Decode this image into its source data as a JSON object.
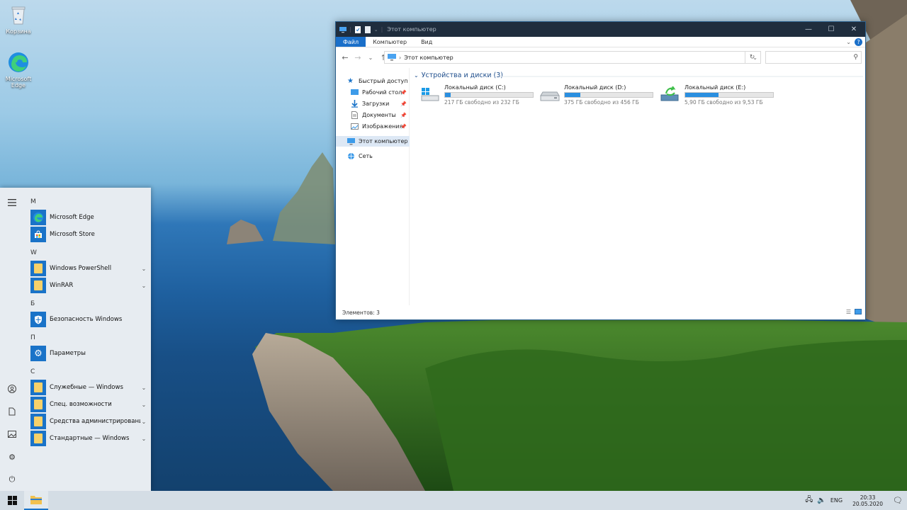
{
  "desktop": {
    "icons": [
      {
        "label": "Корзина",
        "icon": "recycle-bin-icon"
      },
      {
        "label": "Microsoft Edge",
        "icon": "edge-icon"
      }
    ]
  },
  "start_menu": {
    "sections": [
      {
        "letter": "M",
        "items": [
          {
            "label": "Microsoft Edge",
            "icon": "edge-icon",
            "expandable": false
          },
          {
            "label": "Microsoft Store",
            "icon": "store-icon",
            "expandable": false
          }
        ]
      },
      {
        "letter": "W",
        "items": [
          {
            "label": "Windows PowerShell",
            "icon": "folder-icon",
            "expandable": true
          },
          {
            "label": "WinRAR",
            "icon": "folder-icon",
            "expandable": true
          }
        ]
      },
      {
        "letter": "Б",
        "items": [
          {
            "label": "Безопасность Windows",
            "icon": "shield-icon",
            "expandable": false
          }
        ]
      },
      {
        "letter": "П",
        "items": [
          {
            "label": "Параметры",
            "icon": "gear-icon",
            "expandable": false
          }
        ]
      },
      {
        "letter": "С",
        "items": [
          {
            "label": "Служебные — Windows",
            "icon": "folder-icon",
            "expandable": true
          },
          {
            "label": "Спец. возможности",
            "icon": "folder-icon",
            "expandable": true
          },
          {
            "label": "Средства администрирования...",
            "icon": "folder-icon",
            "expandable": true
          },
          {
            "label": "Стандартные — Windows",
            "icon": "folder-icon",
            "expandable": true
          }
        ]
      }
    ],
    "rail_icons": [
      "hamburger-icon",
      "user-icon",
      "document-icon",
      "pictures-icon",
      "settings-icon",
      "power-icon"
    ]
  },
  "explorer": {
    "title": "Этот компьютер",
    "ribbon_tabs": [
      {
        "label": "Файл",
        "active": true
      },
      {
        "label": "Компьютер",
        "active": false
      },
      {
        "label": "Вид",
        "active": false
      }
    ],
    "address": "Этот компьютер",
    "search_placeholder": "",
    "nav_items": [
      {
        "label": "Быстрый доступ",
        "icon": "star-icon",
        "pinned": false,
        "indent": 0,
        "selected": false
      },
      {
        "label": "Рабочий стол",
        "icon": "desktop-icon",
        "pinned": true,
        "indent": 1,
        "selected": false
      },
      {
        "label": "Загрузки",
        "icon": "download-icon",
        "pinned": true,
        "indent": 1,
        "selected": false
      },
      {
        "label": "Документы",
        "icon": "document-icon",
        "pinned": true,
        "indent": 1,
        "selected": false
      },
      {
        "label": "Изображения",
        "icon": "pictures-icon",
        "pinned": true,
        "indent": 1,
        "selected": false
      },
      {
        "label": "Этот компьютер",
        "icon": "computer-icon",
        "pinned": false,
        "indent": 0,
        "selected": true
      },
      {
        "label": "Сеть",
        "icon": "network-icon",
        "pinned": false,
        "indent": 0,
        "selected": false
      }
    ],
    "group_title": "Устройства и диски (3)",
    "drives": [
      {
        "name": "Локальный диск (C:)",
        "free": "217 ГБ свободно из 232 ГБ",
        "used_fraction": 0.065,
        "icon": "windows-drive-icon"
      },
      {
        "name": "Локальный диск (D:)",
        "free": "375 ГБ свободно из 456 ГБ",
        "used_fraction": 0.18,
        "icon": "hard-drive-icon"
      },
      {
        "name": "Локальный диск (E:)",
        "free": "5,90 ГБ свободно из 9,53 ГБ",
        "used_fraction": 0.38,
        "icon": "drive-refresh-icon"
      }
    ],
    "status": "Элементов: 3"
  },
  "taskbar": {
    "language": "ENG",
    "time": "20:33",
    "date": "20.05.2020"
  },
  "colors": {
    "accent": "#1a73c8",
    "titlebar": "#1f2d3d",
    "drive_fill": "#2a8fe0"
  }
}
